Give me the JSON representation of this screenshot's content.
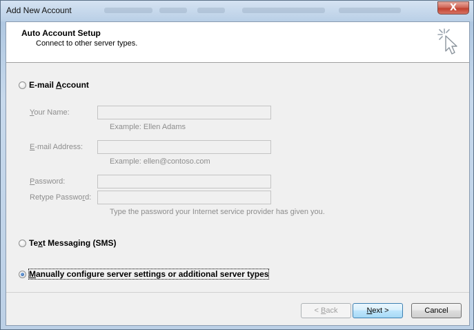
{
  "window": {
    "title": "Add New Account",
    "close_label": "X"
  },
  "header": {
    "title": "Auto Account Setup",
    "subtitle": "Connect to other server types."
  },
  "options": {
    "email": {
      "label_pre": "E-mail ",
      "label_accel": "A",
      "label_post": "ccount",
      "selected": false
    },
    "sms": {
      "label_pre": "Te",
      "label_accel": "x",
      "label_post": "t Messaging (SMS)",
      "selected": false
    },
    "manual": {
      "label_pre": "",
      "label_accel": "M",
      "label_post": "anually configure server settings or additional server types",
      "selected": true
    }
  },
  "fields": {
    "your_name": {
      "label_pre": "",
      "label_accel": "Y",
      "label_post": "our Name:",
      "value": "",
      "example": "Example: Ellen Adams"
    },
    "email_address": {
      "label_pre": "",
      "label_accel": "E",
      "label_post": "-mail Address:",
      "value": "",
      "example": "Example: ellen@contoso.com"
    },
    "password": {
      "label_pre": "",
      "label_accel": "P",
      "label_post": "assword:",
      "value": ""
    },
    "retype_password": {
      "label_pre": "Retype Passwo",
      "label_accel": "r",
      "label_post": "d:",
      "value": "",
      "hint": "Type the password your Internet service provider has given you."
    }
  },
  "buttons": {
    "back": {
      "label_pre": "< ",
      "label_accel": "B",
      "label_post": "ack",
      "enabled": false
    },
    "next": {
      "label_pre": "",
      "label_accel": "N",
      "label_post": "ext >",
      "enabled": true
    },
    "cancel": {
      "label": "Cancel"
    }
  },
  "icons": {
    "header_icon": "click-cursor-icon",
    "close_icon": "close-icon"
  },
  "colors": {
    "titlebar": "#b9cfe6",
    "close": "#c2412f",
    "default_button": "#bee6fd",
    "disabled_text": "#8d8d8d"
  }
}
